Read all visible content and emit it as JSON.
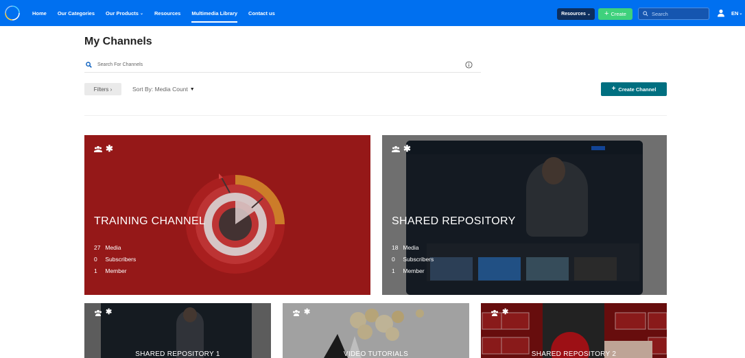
{
  "nav": {
    "links": [
      {
        "label": "Home",
        "active": false,
        "dropdown": false
      },
      {
        "label": "Our Categories",
        "active": false,
        "dropdown": false
      },
      {
        "label": "Our Products",
        "active": false,
        "dropdown": true
      },
      {
        "label": "Resources",
        "active": false,
        "dropdown": false
      },
      {
        "label": "Multimedia Library",
        "active": true,
        "dropdown": false
      },
      {
        "label": "Contact us",
        "active": false,
        "dropdown": false
      }
    ],
    "resources_button": "Resources",
    "create_button": "Create",
    "search_placeholder": "Search",
    "language": "EN",
    "colors": {
      "bar": "#0070f0",
      "create": "#3ed17c",
      "resources": "#0d2f5e"
    }
  },
  "page": {
    "title": "My Channels",
    "search_placeholder": "Search For Channels",
    "filters_label": "Filters ›",
    "sort_label": "Sort By: Media Count",
    "create_channel_label": "Create Channel",
    "accent": "#006f80"
  },
  "channels": [
    {
      "title": "TRAINING CHANNEL",
      "stats": [
        {
          "num": "27",
          "label": "Media"
        },
        {
          "num": "0",
          "label": "Subscribers"
        },
        {
          "num": "1",
          "label": "Member"
        }
      ],
      "icons": [
        "group-icon",
        "asterisk-icon"
      ]
    },
    {
      "title": "SHARED REPOSITORY",
      "stats": [
        {
          "num": "18",
          "label": "Media"
        },
        {
          "num": "0",
          "label": "Subscribers"
        },
        {
          "num": "1",
          "label": "Member"
        }
      ],
      "icons": [
        "group-icon",
        "asterisk-icon"
      ]
    },
    {
      "title": "SHARED REPOSITORY 1",
      "icons": [
        "group-icon",
        "asterisk-icon"
      ]
    },
    {
      "title": "VIDEO TUTORIALS",
      "icons": [
        "group-icon",
        "asterisk-icon"
      ]
    },
    {
      "title": "SHARED REPOSITORY 2",
      "icons": [
        "group-icon",
        "asterisk-icon"
      ]
    }
  ]
}
